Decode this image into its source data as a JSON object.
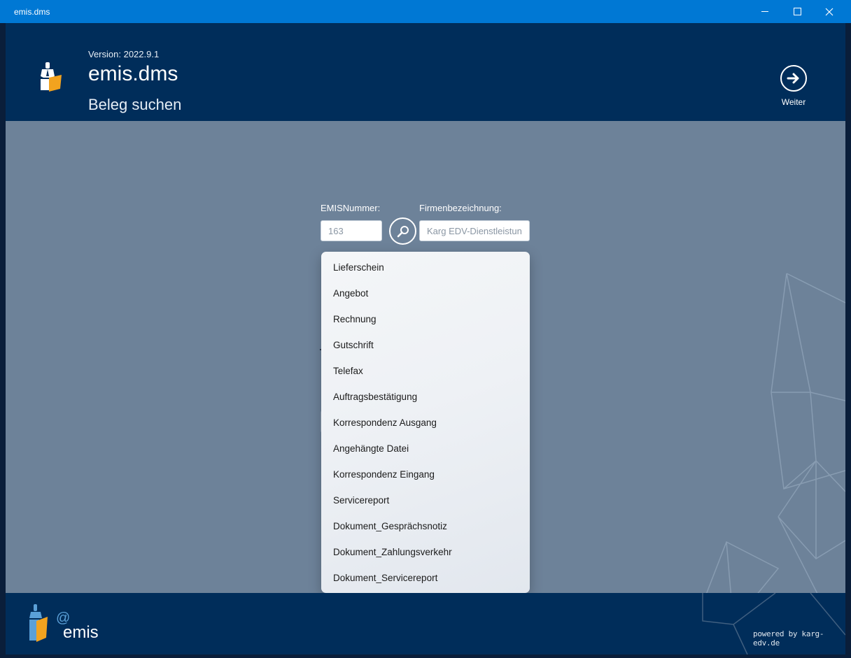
{
  "window": {
    "title": "emis.dms",
    "minimize_icon": "minimize-icon",
    "maximize_icon": "maximize-icon",
    "close_icon": "close-icon",
    "accent_color": "#0078d4"
  },
  "header": {
    "version": "Version: 2022.9.1",
    "app_title": "emis.dms",
    "subtitle": "Beleg suchen",
    "next_label": "Weiter",
    "background": "#002d5a"
  },
  "form": {
    "emis_label": "EMISNummer:",
    "emis_value": "163",
    "firma_label": "Firmenbezeichnung:",
    "firma_value": "Karg EDV-Dienstleistun"
  },
  "dropdown": {
    "items": [
      "Lieferschein",
      "Angebot",
      "Rechnung",
      "Gutschrift",
      "Telefax",
      "Auftragsbestätigung",
      "Korrespondenz Ausgang",
      "Angehängte Datei",
      "Korrespondenz Eingang",
      "Servicereport",
      "Dokument_Gesprächsnotiz",
      "Dokument_Zahlungsverkehr",
      "Dokument_Servicereport"
    ]
  },
  "footer": {
    "logo_text": "emis",
    "powered_by": "powered by karg-edv.de"
  }
}
